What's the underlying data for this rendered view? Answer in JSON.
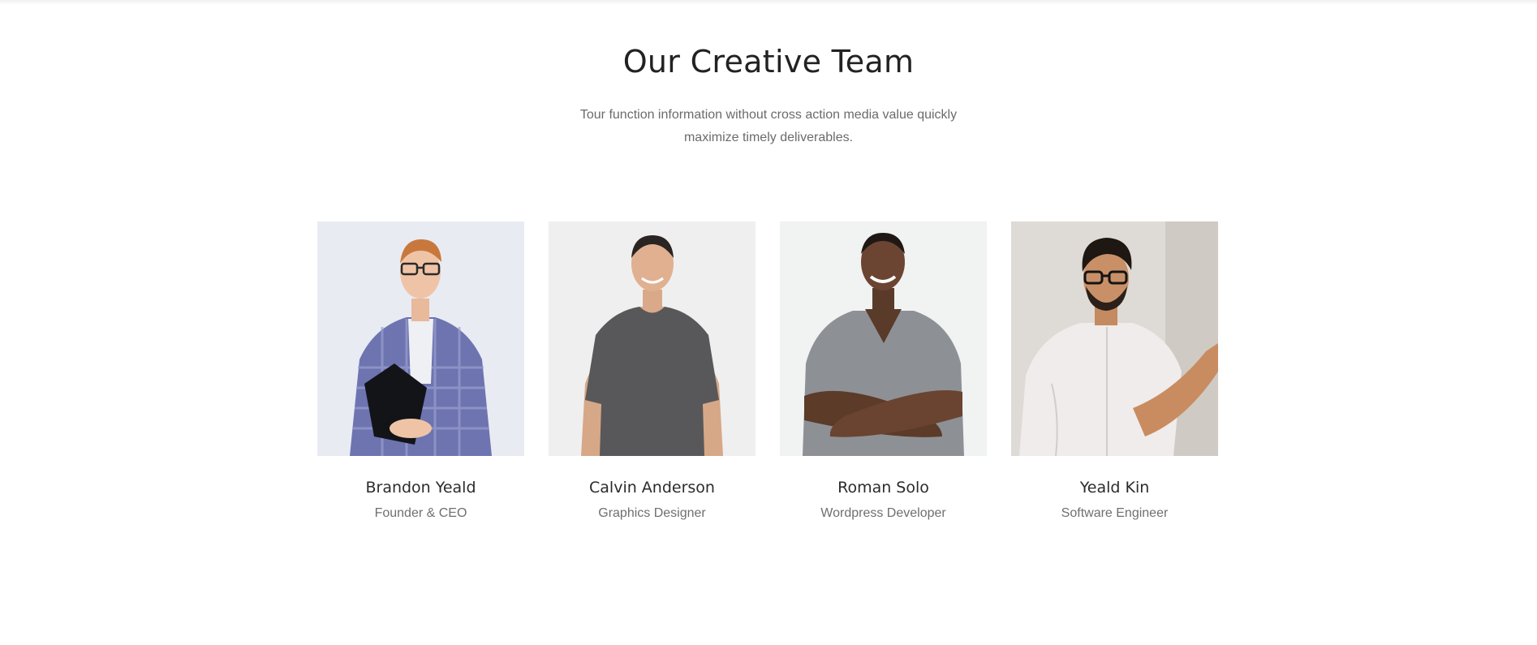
{
  "section": {
    "title": "Our Creative Team",
    "subtitle": "Tour function information without cross action media value quickly maximize timely deliverables."
  },
  "team": [
    {
      "name": "Brandon Yeald",
      "role": "Founder & CEO",
      "photo_icon": "person-photo"
    },
    {
      "name": "Calvin Anderson",
      "role": "Graphics Designer",
      "photo_icon": "person-photo"
    },
    {
      "name": "Roman Solo",
      "role": "Wordpress Developer",
      "photo_icon": "person-photo"
    },
    {
      "name": "Yeald Kin",
      "role": "Software Engineer",
      "photo_icon": "person-photo"
    }
  ],
  "colors": {
    "heading": "#222222",
    "body_text": "#6b6b6b",
    "background": "#ffffff"
  }
}
